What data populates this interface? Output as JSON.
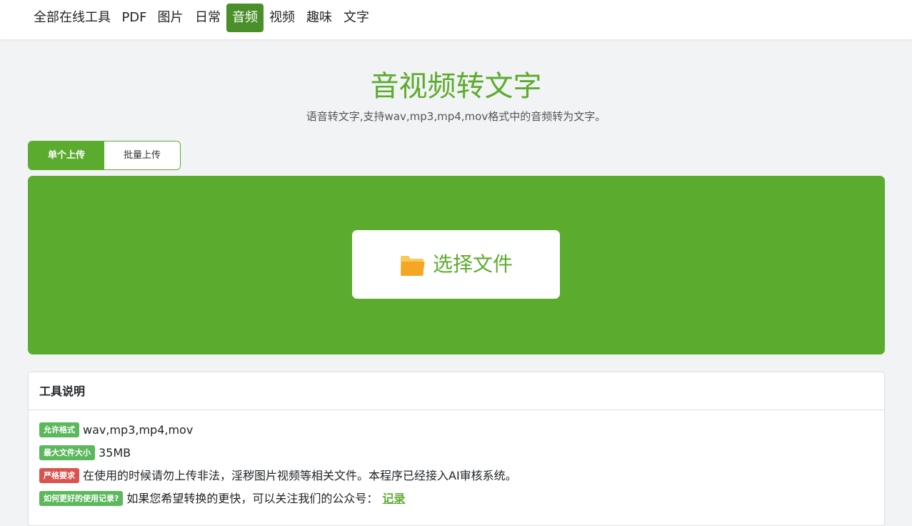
{
  "nav": {
    "items": [
      {
        "label": "全部在线工具"
      },
      {
        "label": "PDF"
      },
      {
        "label": "图片"
      },
      {
        "label": "日常"
      },
      {
        "label": "音频",
        "active": true
      },
      {
        "label": "视频"
      },
      {
        "label": "趣味"
      },
      {
        "label": "文字"
      }
    ]
  },
  "header": {
    "title": "音视频转文字",
    "subtitle": "语音转文字,支持wav,mp3,mp4,mov格式中的音频转为文字。"
  },
  "upload_tabs": {
    "single": "单个上传",
    "batch": "批量上传",
    "selected": "single"
  },
  "dropzone": {
    "button_label": "选择文件",
    "icon": "folder-icon"
  },
  "info": {
    "title": "工具说明",
    "rows": [
      {
        "badge": "允许格式",
        "badge_color": "#5cb85c",
        "text": "wav,mp3,mp4,mov"
      },
      {
        "badge": "最大文件大小",
        "badge_color": "#5cb85c",
        "text": "35MB"
      },
      {
        "badge": "严格要求",
        "badge_color": "#d9534f",
        "text": "在使用的时候请勿上传非法，淫秽图片视频等相关文件。本程序已经接入AI审核系统。"
      },
      {
        "badge": "如何更好的使用记录?",
        "badge_color": "#5cb85c",
        "text": "如果您希望转换的更快，可以关注我们的公众号：",
        "link": "记录"
      }
    ]
  },
  "colors": {
    "accent": "#5bac2e",
    "nav_active": "#4a8f2a",
    "danger": "#d9534f",
    "background": "#f2f3f5"
  }
}
